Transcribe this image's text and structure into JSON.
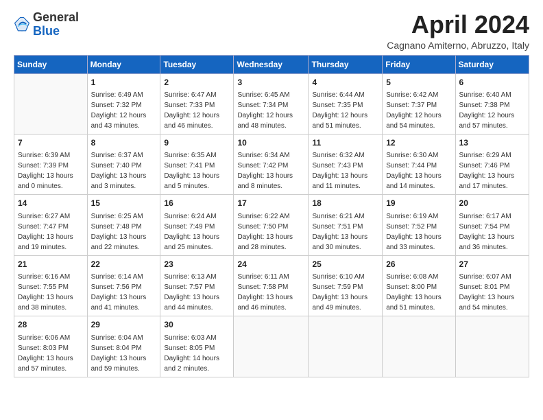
{
  "header": {
    "logo_general": "General",
    "logo_blue": "Blue",
    "title": "April 2024",
    "location": "Cagnano Amiterno, Abruzzo, Italy"
  },
  "weekdays": [
    "Sunday",
    "Monday",
    "Tuesday",
    "Wednesday",
    "Thursday",
    "Friday",
    "Saturday"
  ],
  "weeks": [
    [
      {
        "day": "",
        "info": ""
      },
      {
        "day": "1",
        "info": "Sunrise: 6:49 AM\nSunset: 7:32 PM\nDaylight: 12 hours\nand 43 minutes."
      },
      {
        "day": "2",
        "info": "Sunrise: 6:47 AM\nSunset: 7:33 PM\nDaylight: 12 hours\nand 46 minutes."
      },
      {
        "day": "3",
        "info": "Sunrise: 6:45 AM\nSunset: 7:34 PM\nDaylight: 12 hours\nand 48 minutes."
      },
      {
        "day": "4",
        "info": "Sunrise: 6:44 AM\nSunset: 7:35 PM\nDaylight: 12 hours\nand 51 minutes."
      },
      {
        "day": "5",
        "info": "Sunrise: 6:42 AM\nSunset: 7:37 PM\nDaylight: 12 hours\nand 54 minutes."
      },
      {
        "day": "6",
        "info": "Sunrise: 6:40 AM\nSunset: 7:38 PM\nDaylight: 12 hours\nand 57 minutes."
      }
    ],
    [
      {
        "day": "7",
        "info": "Sunrise: 6:39 AM\nSunset: 7:39 PM\nDaylight: 13 hours\nand 0 minutes."
      },
      {
        "day": "8",
        "info": "Sunrise: 6:37 AM\nSunset: 7:40 PM\nDaylight: 13 hours\nand 3 minutes."
      },
      {
        "day": "9",
        "info": "Sunrise: 6:35 AM\nSunset: 7:41 PM\nDaylight: 13 hours\nand 5 minutes."
      },
      {
        "day": "10",
        "info": "Sunrise: 6:34 AM\nSunset: 7:42 PM\nDaylight: 13 hours\nand 8 minutes."
      },
      {
        "day": "11",
        "info": "Sunrise: 6:32 AM\nSunset: 7:43 PM\nDaylight: 13 hours\nand 11 minutes."
      },
      {
        "day": "12",
        "info": "Sunrise: 6:30 AM\nSunset: 7:44 PM\nDaylight: 13 hours\nand 14 minutes."
      },
      {
        "day": "13",
        "info": "Sunrise: 6:29 AM\nSunset: 7:46 PM\nDaylight: 13 hours\nand 17 minutes."
      }
    ],
    [
      {
        "day": "14",
        "info": "Sunrise: 6:27 AM\nSunset: 7:47 PM\nDaylight: 13 hours\nand 19 minutes."
      },
      {
        "day": "15",
        "info": "Sunrise: 6:25 AM\nSunset: 7:48 PM\nDaylight: 13 hours\nand 22 minutes."
      },
      {
        "day": "16",
        "info": "Sunrise: 6:24 AM\nSunset: 7:49 PM\nDaylight: 13 hours\nand 25 minutes."
      },
      {
        "day": "17",
        "info": "Sunrise: 6:22 AM\nSunset: 7:50 PM\nDaylight: 13 hours\nand 28 minutes."
      },
      {
        "day": "18",
        "info": "Sunrise: 6:21 AM\nSunset: 7:51 PM\nDaylight: 13 hours\nand 30 minutes."
      },
      {
        "day": "19",
        "info": "Sunrise: 6:19 AM\nSunset: 7:52 PM\nDaylight: 13 hours\nand 33 minutes."
      },
      {
        "day": "20",
        "info": "Sunrise: 6:17 AM\nSunset: 7:54 PM\nDaylight: 13 hours\nand 36 minutes."
      }
    ],
    [
      {
        "day": "21",
        "info": "Sunrise: 6:16 AM\nSunset: 7:55 PM\nDaylight: 13 hours\nand 38 minutes."
      },
      {
        "day": "22",
        "info": "Sunrise: 6:14 AM\nSunset: 7:56 PM\nDaylight: 13 hours\nand 41 minutes."
      },
      {
        "day": "23",
        "info": "Sunrise: 6:13 AM\nSunset: 7:57 PM\nDaylight: 13 hours\nand 44 minutes."
      },
      {
        "day": "24",
        "info": "Sunrise: 6:11 AM\nSunset: 7:58 PM\nDaylight: 13 hours\nand 46 minutes."
      },
      {
        "day": "25",
        "info": "Sunrise: 6:10 AM\nSunset: 7:59 PM\nDaylight: 13 hours\nand 49 minutes."
      },
      {
        "day": "26",
        "info": "Sunrise: 6:08 AM\nSunset: 8:00 PM\nDaylight: 13 hours\nand 51 minutes."
      },
      {
        "day": "27",
        "info": "Sunrise: 6:07 AM\nSunset: 8:01 PM\nDaylight: 13 hours\nand 54 minutes."
      }
    ],
    [
      {
        "day": "28",
        "info": "Sunrise: 6:06 AM\nSunset: 8:03 PM\nDaylight: 13 hours\nand 57 minutes."
      },
      {
        "day": "29",
        "info": "Sunrise: 6:04 AM\nSunset: 8:04 PM\nDaylight: 13 hours\nand 59 minutes."
      },
      {
        "day": "30",
        "info": "Sunrise: 6:03 AM\nSunset: 8:05 PM\nDaylight: 14 hours\nand 2 minutes."
      },
      {
        "day": "",
        "info": ""
      },
      {
        "day": "",
        "info": ""
      },
      {
        "day": "",
        "info": ""
      },
      {
        "day": "",
        "info": ""
      }
    ]
  ]
}
